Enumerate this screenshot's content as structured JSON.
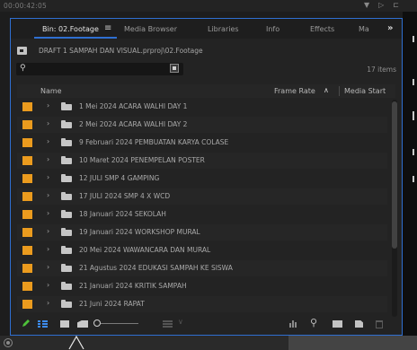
{
  "timecode": "00:00:42:05",
  "tabs": [
    {
      "label": "Bin: 02.Footage",
      "active": true
    },
    {
      "label": "Media Browser",
      "active": false
    },
    {
      "label": "Libraries",
      "active": false
    },
    {
      "label": "Info",
      "active": false
    },
    {
      "label": "Effects",
      "active": false
    },
    {
      "label": "Ma",
      "active": false
    }
  ],
  "tab_menu_glyph": "≡",
  "tab_more_glyph": "»",
  "path": "DRAFT 1 SAMPAH DAN VISUAL.prproj\\02.Footage",
  "search": {
    "value": "",
    "placeholder": ""
  },
  "item_count": "17 items",
  "columns": {
    "name": "Name",
    "frame_rate": "Frame Rate",
    "media_start": "Media Start",
    "sort_glyph": "∧"
  },
  "items": [
    {
      "label": "1 Mei 2024 ACARA WALHI DAY 1"
    },
    {
      "label": "2 Mei 2024 ACARA WALHI DAY 2"
    },
    {
      "label": "9 Februari 2024 PEMBUATAN KARYA COLASE"
    },
    {
      "label": "10 Maret 2024 PENEMPELAN POSTER"
    },
    {
      "label": "12 JULI SMP 4 GAMPING"
    },
    {
      "label": "17 JULI 2024 SMP 4 X WCD"
    },
    {
      "label": "18 Januari 2024 SEKOLAH"
    },
    {
      "label": "19 Januari 2024 WORKSHOP MURAL"
    },
    {
      "label": "20 Mei 2024 WAWANCARA DAN MURAL"
    },
    {
      "label": "21 Agustus 2024 EDUKASI SAMPAH KE SISWA"
    },
    {
      "label": "21 Januari 2024 KRITIK SAMPAH"
    },
    {
      "label": "21 Juni 2024 RAPAT"
    }
  ],
  "colors": {
    "label_orange": "#eb9b1e",
    "accent_blue": "#2f6fd1",
    "pencil_green": "#4ec23a",
    "list_blue": "#3d8cf0"
  },
  "icons": {
    "chevron": "›",
    "search": "⚲",
    "find": "⚲"
  }
}
